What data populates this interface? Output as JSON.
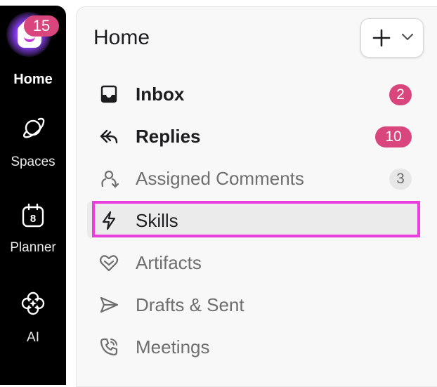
{
  "rail": {
    "home_badge": "15",
    "home_label": "Home",
    "spaces_label": "Spaces",
    "planner_label": "Planner",
    "planner_day": "8",
    "ai_label": "AI",
    "icons": [
      "app-logo-icon",
      "planet-icon",
      "calendar-icon",
      "ai-flower-icon"
    ]
  },
  "header": {
    "title": "Home",
    "add_button_icons": [
      "plus-icon",
      "chevron-down-icon"
    ]
  },
  "nav": {
    "items": [
      {
        "label": "Inbox",
        "icon": "inbox-tray-icon",
        "badge": "2",
        "weight": "bold"
      },
      {
        "label": "Replies",
        "icon": "reply-arrow-icon",
        "badge": "10",
        "weight": "bold"
      },
      {
        "label": "Assigned Comments",
        "icon": "assigned-comments-icon",
        "badge": "3",
        "weight": "muted"
      },
      {
        "label": "Skills",
        "icon": "lightning-icon",
        "state": "selected"
      },
      {
        "label": "Artifacts",
        "icon": "heart-icon"
      },
      {
        "label": "Drafts & Sent",
        "icon": "send-icon"
      },
      {
        "label": "Meetings",
        "icon": "phone-icon"
      }
    ]
  },
  "colors": {
    "badge_pink": "#d9457d",
    "highlight": "#ea3fdc",
    "rail_bg": "#000000",
    "panel_bg": "#f8f8f8"
  }
}
